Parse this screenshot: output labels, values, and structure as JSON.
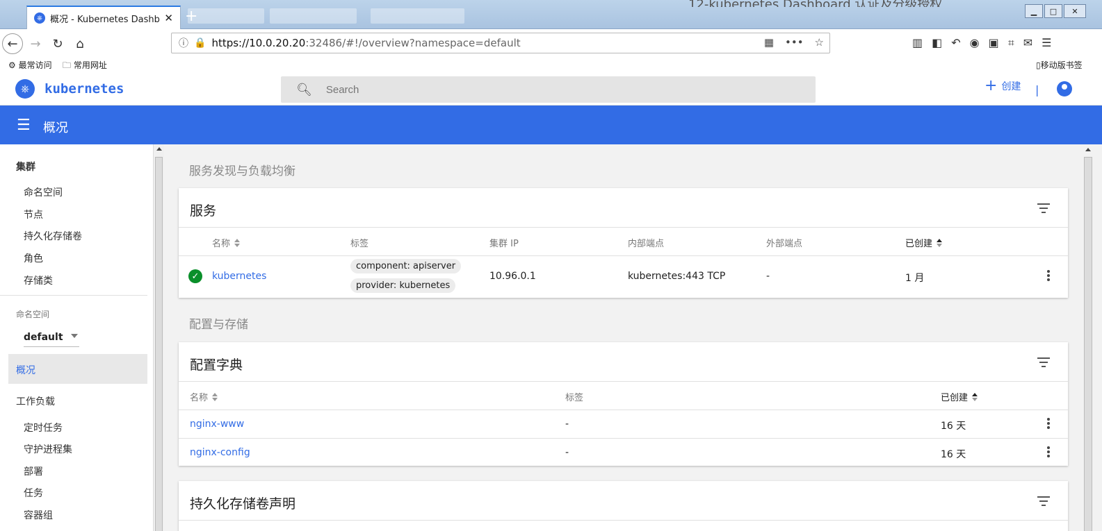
{
  "browser": {
    "tab_title": "概况 - Kubernetes Dashboard",
    "background_window_title": "12-kubernetes Dashboard 认证及分级授权",
    "url_host": "https://10.0.20.20",
    "url_rest": ":32486/#!/overview?namespace=default",
    "bookmarks": [
      "最常访问",
      "常用网址"
    ],
    "mobile_bookmarks": "移动版书签"
  },
  "header": {
    "logo_text": "kubernetes",
    "search_placeholder": "Search",
    "create_label": "创建",
    "separator": "|"
  },
  "toolbar": {
    "title": "概况"
  },
  "sidebar": {
    "cluster_heading": "集群",
    "cluster_items": [
      "命名空间",
      "节点",
      "持久化存储卷",
      "角色",
      "存储类"
    ],
    "namespace_label": "命名空间",
    "namespace_value": "default",
    "overview": "概况",
    "workloads_heading": "工作负载",
    "workload_items": [
      "定时任务",
      "守护进程集",
      "部署",
      "任务",
      "容器组"
    ]
  },
  "main": {
    "section_discovery": "服务发现与负载均衡",
    "services": {
      "title": "服务",
      "columns": [
        "名称",
        "标签",
        "集群 IP",
        "内部端点",
        "外部端点",
        "已创建"
      ],
      "rows": [
        {
          "name": "kubernetes",
          "labels": [
            "component: apiserver",
            "provider: kubernetes"
          ],
          "cluster_ip": "10.96.0.1",
          "internal_endpoint": "kubernetes:443 TCP",
          "external_endpoint": "-",
          "created": "1 月"
        }
      ]
    },
    "section_config": "配置与存储",
    "configmaps": {
      "title": "配置字典",
      "columns": [
        "名称",
        "标签",
        "已创建"
      ],
      "rows": [
        {
          "name": "nginx-www",
          "labels": "-",
          "created": "16 天"
        },
        {
          "name": "nginx-config",
          "labels": "-",
          "created": "16 天"
        }
      ]
    },
    "pvc": {
      "title": "持久化存储卷声明"
    }
  },
  "colors": {
    "primary": "#326ce5",
    "success": "#0a8f2a"
  }
}
